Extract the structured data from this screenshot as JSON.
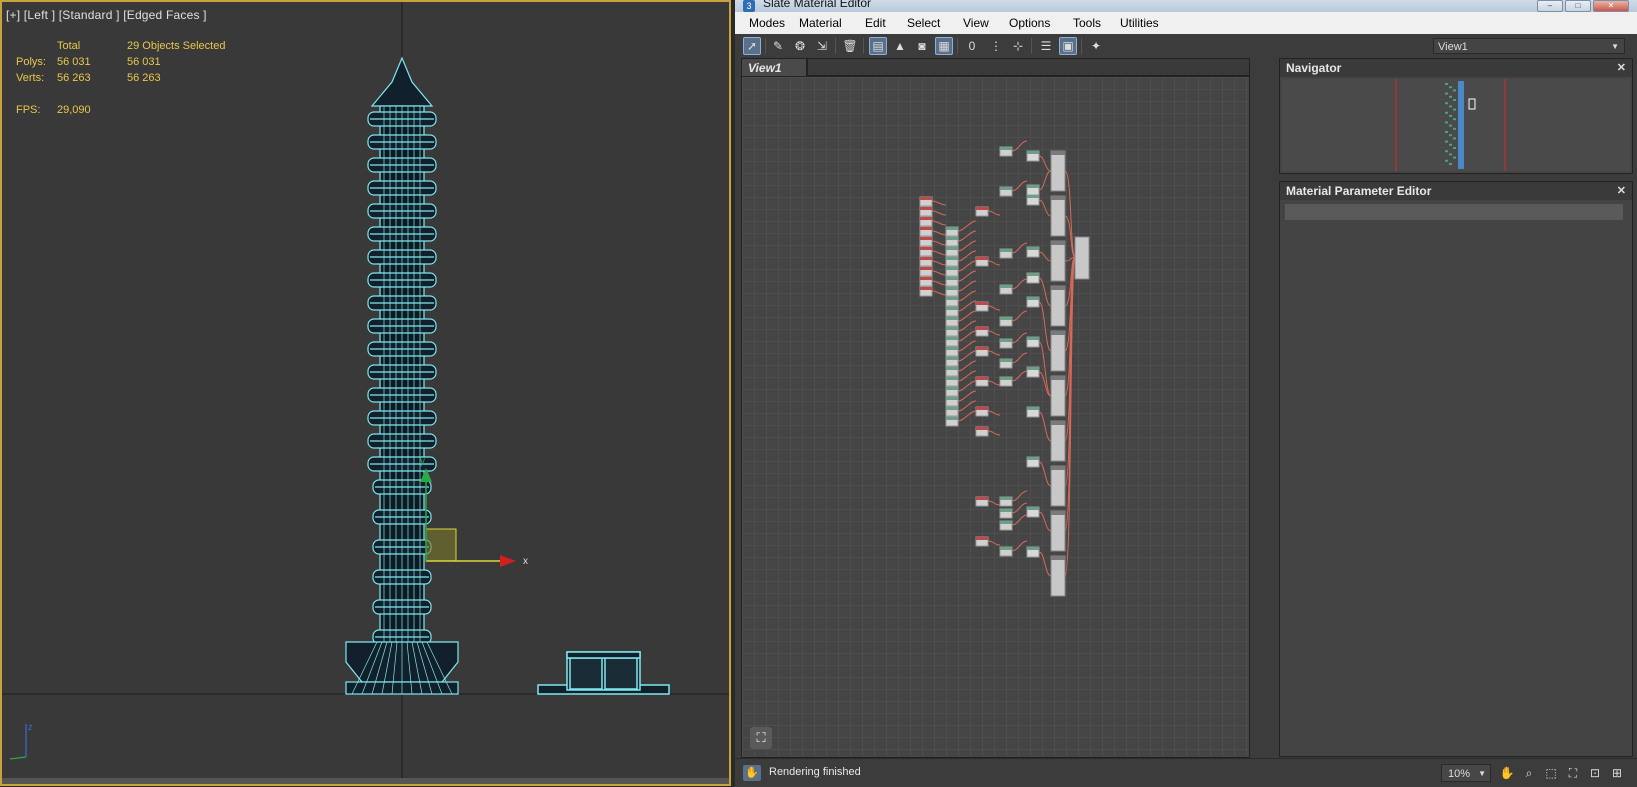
{
  "viewport": {
    "label": "[+] [Left ] [Standard ] [Edged Faces ]",
    "stats": {
      "col_total": "Total",
      "col_selected": "29 Objects Selected",
      "polys_label": "Polys:",
      "polys_total": "56 031",
      "polys_selected": "56 031",
      "verts_label": "Verts:",
      "verts_total": "56 263",
      "verts_selected": "56 263",
      "fps_label": "FPS:",
      "fps_value": "29,090"
    },
    "gizmo_axis_x": "x",
    "gizmo_axis_y": "y",
    "axis_z": "z",
    "colors": {
      "wire": "#7fe8f0",
      "selection_border": "#c8a33b",
      "stats_text": "#e8c84a"
    }
  },
  "editor": {
    "title": "Slate Material Editor",
    "app_icon": "3",
    "window_controls": [
      "minimize-icon",
      "maximize-icon",
      "close-icon"
    ],
    "menu": [
      "Modes",
      "Material",
      "Edit",
      "Select",
      "View",
      "Options",
      "Tools",
      "Utilities"
    ],
    "toolbar_icons": [
      "select-tool-icon",
      "pick-material-icon",
      "get-material-icon",
      "put-to-scene-icon",
      "delete-icon",
      "move-children-icon",
      "show-bg-icon",
      "layout-all-icon",
      "show-map-icon",
      "background-icon",
      "render-id-icon",
      "hide-unused-icon",
      "layout-icon",
      "layout-children-icon",
      "properties-icon",
      "navigator-icon",
      "magic-icon"
    ],
    "view_select": "View1",
    "view_tab": "View1",
    "panels": {
      "navigator": "Navigator",
      "material_parameter_editor": "Material Parameter Editor"
    },
    "status": "Rendering finished",
    "zoom": "10%",
    "status_icons": [
      "pan-icon",
      "zoom-icon",
      "zoom-region-icon",
      "zoom-extents-icon",
      "zoom-selected-icon",
      "maximize-view-icon"
    ]
  }
}
